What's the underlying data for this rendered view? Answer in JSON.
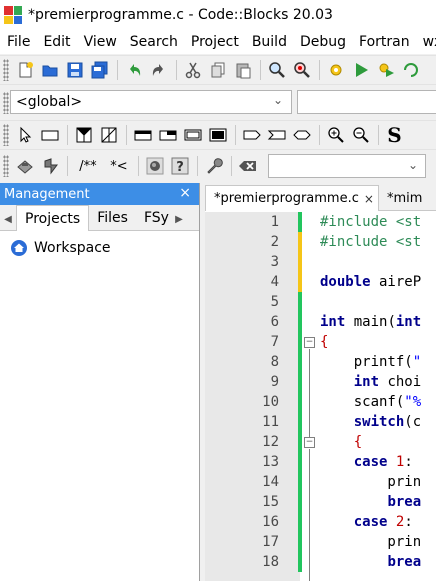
{
  "window": {
    "title": "*premierprogramme.c - Code::Blocks 20.03"
  },
  "menu": [
    "File",
    "Edit",
    "View",
    "Search",
    "Project",
    "Build",
    "Debug",
    "Fortran",
    "wxS"
  ],
  "scope": {
    "selected": "<global>"
  },
  "management": {
    "title": "Management",
    "close_glyph": "×",
    "tabs": [
      "Projects",
      "Files",
      "FSy"
    ],
    "tree_root": "Workspace"
  },
  "editor": {
    "tabs": [
      {
        "label": "*premierprogramme.c",
        "close": "×"
      },
      {
        "label": "*mim"
      }
    ],
    "lines": [
      {
        "n": "1"
      },
      {
        "n": "2"
      },
      {
        "n": "3"
      },
      {
        "n": "4"
      },
      {
        "n": "5"
      },
      {
        "n": "6"
      },
      {
        "n": "7"
      },
      {
        "n": "8"
      },
      {
        "n": "9"
      },
      {
        "n": "10"
      },
      {
        "n": "11"
      },
      {
        "n": "12"
      },
      {
        "n": "13"
      },
      {
        "n": "14"
      },
      {
        "n": "15"
      },
      {
        "n": "16"
      },
      {
        "n": "17"
      },
      {
        "n": "18"
      }
    ],
    "code": {
      "l1": "#include <st",
      "l2": "#include <st",
      "l4a": "double",
      "l4b": " aireP",
      "l6a": "int",
      "l6b": " main(",
      "l6c": "int",
      "l7": "{",
      "l8a": "    printf(",
      "l8b": "\"",
      "l9a": "    ",
      "l9b": "int",
      "l9c": " choi",
      "l10a": "    scanf(",
      "l10b": "\"%",
      "l11a": "    ",
      "l11b": "switch",
      "l11c": "(c",
      "l12": "    {",
      "l13a": "    ",
      "l13b": "case",
      "l13c": " ",
      "l13d": "1",
      "l13e": ":",
      "l14": "        prin",
      "l15a": "        ",
      "l15b": "brea",
      "l16a": "    ",
      "l16b": "case",
      "l16c": " ",
      "l16d": "2",
      "l16e": ":",
      "l17": "        prin",
      "l18a": "        ",
      "l18b": "brea"
    },
    "change_markers": [
      "green",
      "yellow",
      "yellow",
      "yellow",
      "green",
      "green",
      "green",
      "green",
      "green",
      "green",
      "green",
      "green",
      "green",
      "green",
      "green",
      "green",
      "green",
      "green"
    ]
  },
  "toolbar_icons": {
    "row1": [
      "new-file-icon",
      "open-icon",
      "save-icon",
      "save-all-icon",
      "undo-icon",
      "redo-icon",
      "cut-icon",
      "copy-icon",
      "paste-icon",
      "find-icon",
      "replace-icon",
      "build-icon",
      "run-icon",
      "build-run-icon",
      "rebuild-icon"
    ],
    "row2": [
      "select-icon",
      "rect-icon",
      "checked-box-icon",
      "crossed-box-icon",
      "block1-icon",
      "block2-icon",
      "block3-icon",
      "block4-icon",
      "arrow-box1-icon",
      "arrow-box2-icon",
      "arrow-box3-icon",
      "zoom-in-icon",
      "zoom-out-icon",
      "s-icon"
    ],
    "row3": [
      "comment-icon",
      "doxy-block",
      "doxy-line",
      "globe-icon",
      "help-icon",
      "wrench-icon",
      "clear-icon"
    ],
    "row3_text": {
      "doxy_block": "/**",
      "doxy_line": "*<",
      "big_s": "S"
    }
  },
  "colors": {
    "accent": "#3d8ee6",
    "green": "#22c55e",
    "yellow": "#f5c518"
  }
}
